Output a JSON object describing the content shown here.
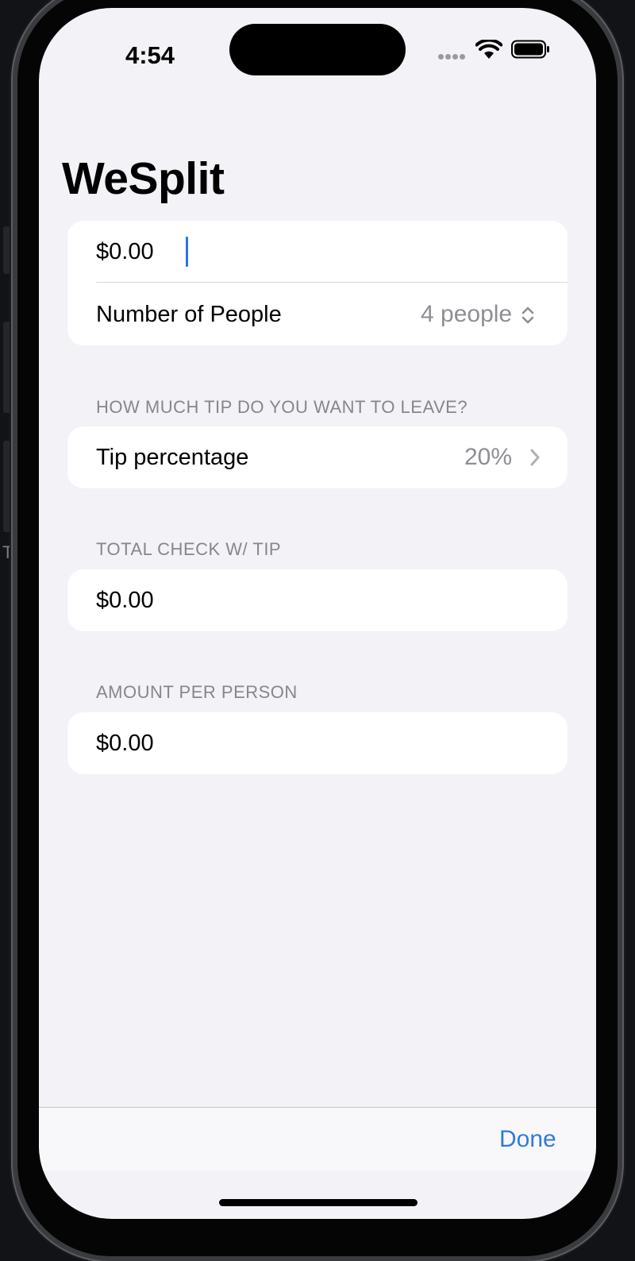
{
  "status_bar": {
    "time": "4:54",
    "signal_icon": "cellular-dots-icon",
    "wifi_icon": "wifi-icon",
    "battery_icon": "battery-icon"
  },
  "nav": {
    "title": "WeSplit"
  },
  "bill_section": {
    "amount_value": "$0.00",
    "people_label": "Number of People",
    "people_value": "4 people",
    "people_picker_icon": "chevron-up-down-icon"
  },
  "tip_section": {
    "header": "HOW MUCH TIP DO YOU WANT TO LEAVE?",
    "label": "Tip percentage",
    "value": "20%",
    "disclosure_icon": "chevron-right-icon"
  },
  "total_section": {
    "header": "TOTAL CHECK W/ TIP",
    "value": "$0.00"
  },
  "per_person_section": {
    "header": "AMOUNT PER PERSON",
    "value": "$0.00"
  },
  "keyboard_toolbar": {
    "done_label": "Done"
  },
  "background": {
    "edge_letter": "T"
  },
  "colors": {
    "accent": "#2f7bde",
    "caret": "#2f6fed",
    "screen_background": "#f2f2f7",
    "card_background": "#ffffff",
    "secondary_text": "#8e8e93"
  }
}
